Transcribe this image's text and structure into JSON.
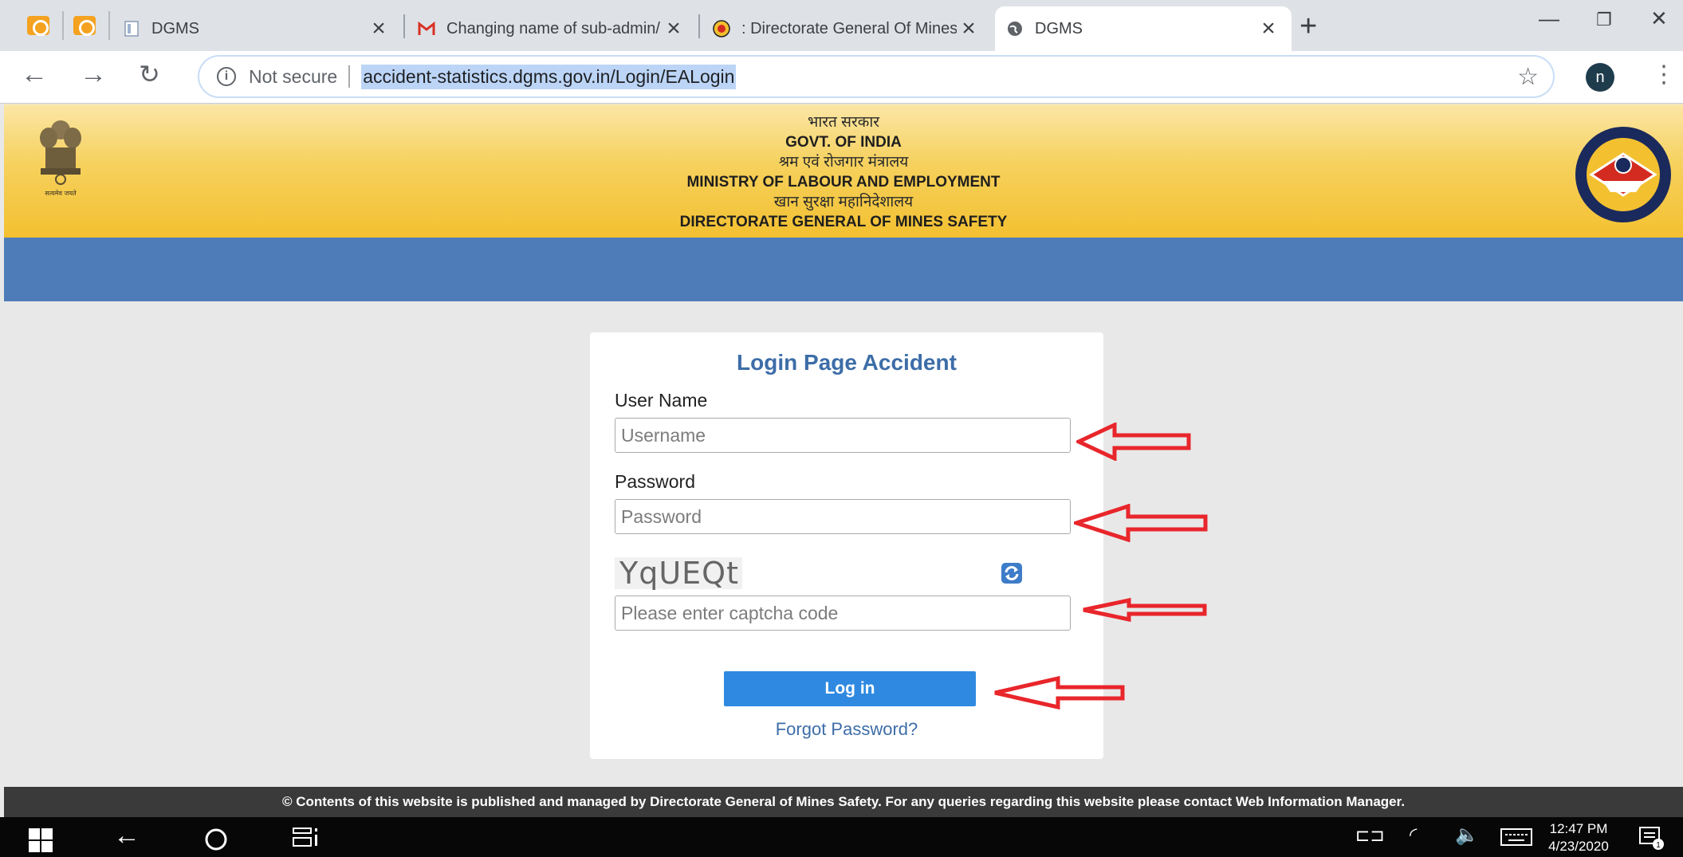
{
  "browser": {
    "tabs": [
      {
        "label": "DGMS"
      },
      {
        "label": "Changing name of sub-admin/"
      },
      {
        "label": ": Directorate General Of Mines"
      },
      {
        "label": "DGMS"
      }
    ],
    "security_label": "Not secure",
    "url": "accident-statistics.dgms.gov.in/Login/EALogin",
    "profile_initial": "n"
  },
  "header": {
    "line1_hi": "भारत सरकार",
    "line2_en": "GOVT. OF INDIA",
    "line3_hi": "श्रम एवं रोजगार मंत्रालय",
    "line4_en": "MINISTRY OF LABOUR AND EMPLOYMENT",
    "line5_hi": "खान सुरक्षा महानिदेशालय",
    "line6_en": "DIRECTORATE GENERAL OF MINES SAFETY",
    "emblem_motto": "सत्यमेव जयते"
  },
  "login": {
    "title": "Login Page Accident",
    "username_label": "User Name",
    "username_placeholder": "Username",
    "password_label": "Password",
    "password_placeholder": "Password",
    "captcha_text": "YqUEQt",
    "captcha_placeholder": "Please enter captcha code",
    "submit_label": "Log in",
    "forgot_label": "Forgot Password?"
  },
  "footer": {
    "text": "© Contents of this website is published and managed by Directorate General of Mines Safety. For any queries regarding this website please contact Web Information Manager."
  },
  "taskbar": {
    "time": "12:47 PM",
    "date": "4/23/2020",
    "notification_count": "1"
  },
  "colors": {
    "header_gold": "#f6d15d",
    "band_blue": "#4e7cb8",
    "title_blue": "#3d6da8",
    "button_blue": "#2f89e0",
    "arrow_red": "#e8262b"
  }
}
